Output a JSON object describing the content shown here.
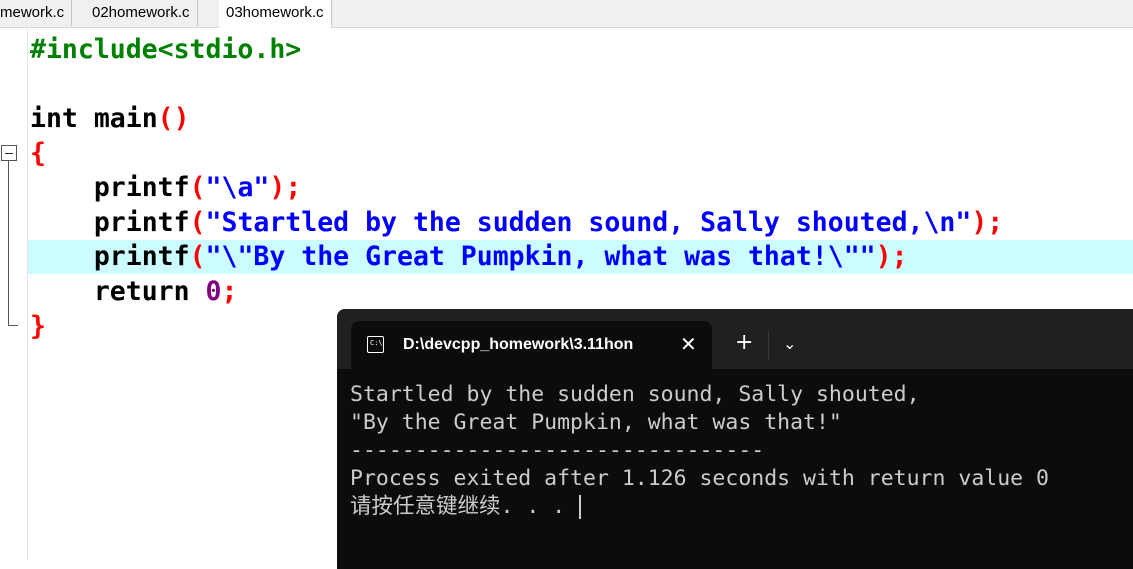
{
  "tabs": [
    {
      "label": "mework.c",
      "active": false
    },
    {
      "label": "02homework.c",
      "active": false
    },
    {
      "label": "03homework.c",
      "active": true
    }
  ],
  "code": {
    "line1": {
      "pp": "#include<stdio.h>"
    },
    "line3": {
      "kw": "int",
      "name": " main",
      "paren": "()"
    },
    "line4": {
      "brace": "{"
    },
    "line5": {
      "indent": "    ",
      "fn": "printf",
      "open": "(",
      "str": "\"\\a\"",
      "close": ");"
    },
    "line6": {
      "indent": "    ",
      "fn": "printf",
      "open": "(",
      "str": "\"Startled by the sudden sound, Sally shouted,\\n\"",
      "close": ");"
    },
    "line7": {
      "indent": "    ",
      "fn": "printf",
      "open": "(",
      "str": "\"\\\"By the Great Pumpkin, what was that!\\\"\"",
      "close": ");"
    },
    "line8": {
      "indent": "    ",
      "kw": "return ",
      "num": "0",
      "semi": ";"
    },
    "line9": {
      "brace": "}"
    }
  },
  "terminal": {
    "title": "D:\\devcpp_homework\\3.11hon",
    "icon": "cmd-icon",
    "close": "✕",
    "add": "+",
    "dropdown": "⌄",
    "lines": [
      "Startled by the sudden sound, Sally shouted,",
      "\"By the Great Pumpkin, what was that!\"",
      "--------------------------------",
      "Process exited after 1.126 seconds with return value 0",
      "请按任意键继续. . ."
    ]
  },
  "colors": {
    "preprocessor": "#008000",
    "keyword": "#000000",
    "brace": "#ff0000",
    "string": "#0000ff",
    "number": "#800080",
    "highlight_line": "#ccfcff",
    "terminal_bg": "#0c0c0c"
  }
}
